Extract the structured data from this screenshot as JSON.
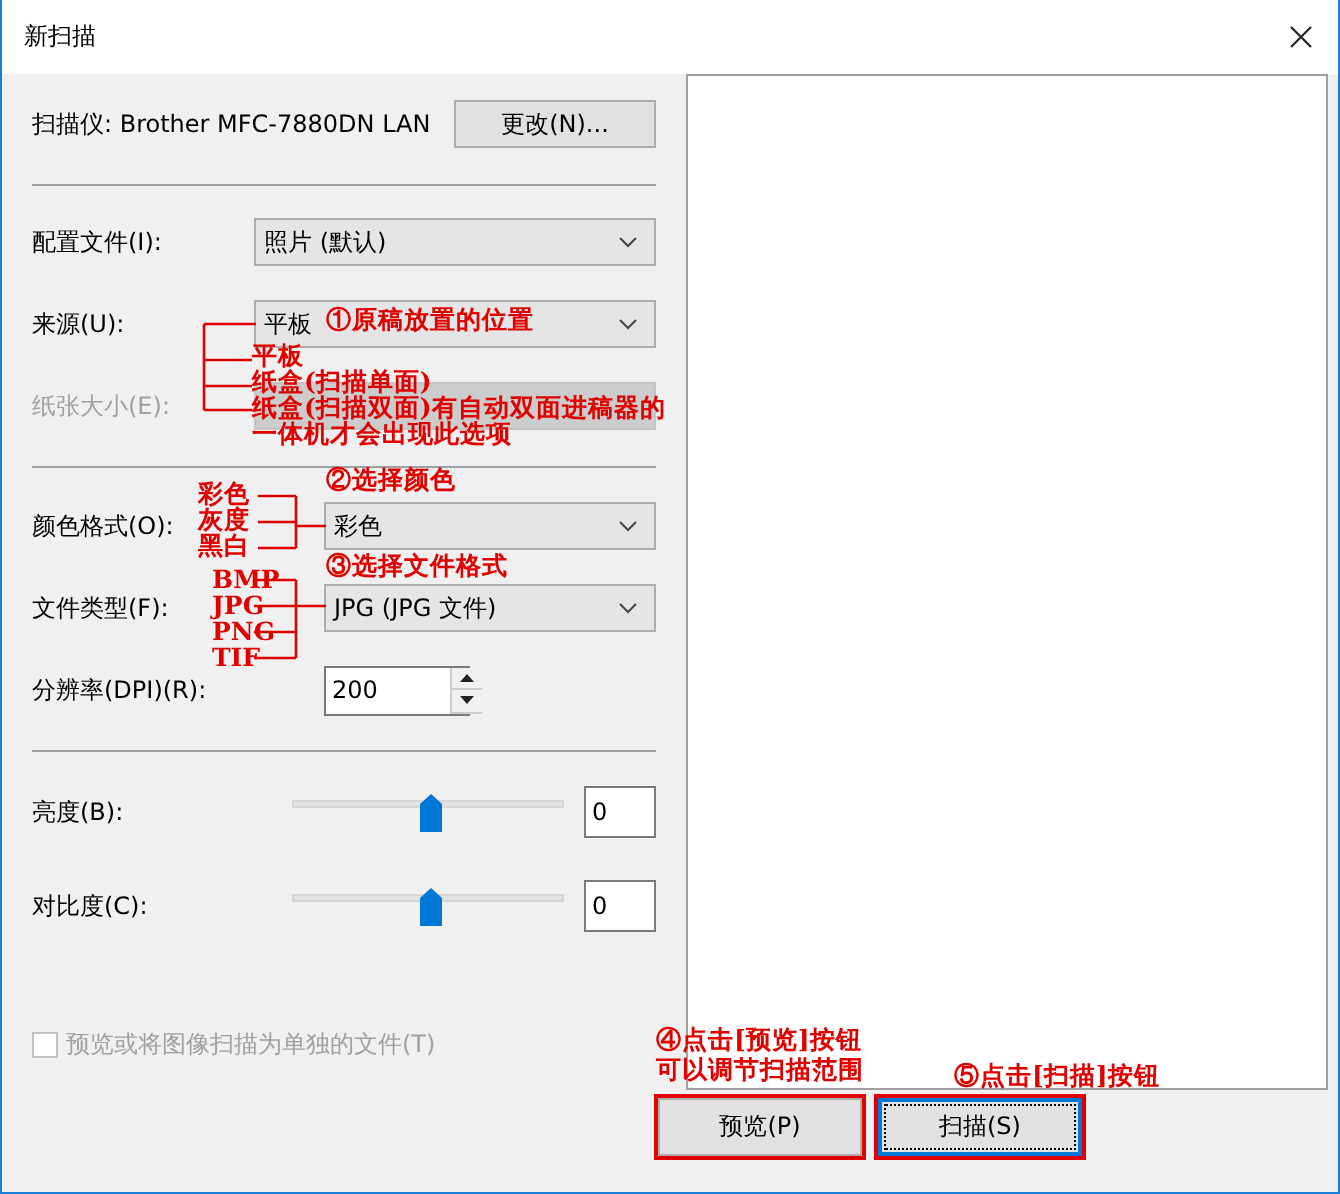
{
  "window": {
    "title": "新扫描"
  },
  "scanner": {
    "label": "扫描仪: Brother MFC-7880DN LAN",
    "button": "更改(N)..."
  },
  "groups": [
    [
      {
        "kind": "dropdown",
        "label": "配置文件(I):",
        "value": "照片 (默认)",
        "disabled": false
      },
      {
        "kind": "dropdown",
        "label": "来源(U):",
        "value": "平板",
        "disabled": false
      },
      {
        "kind": "dropdown",
        "label": "纸张大小(E):",
        "disabled": true
      }
    ],
    [
      {
        "kind": "dropdown",
        "label": "颜色格式(O):",
        "value": "彩色",
        "disabled": false
      },
      {
        "kind": "dropdown",
        "label": "文件类型(F):",
        "value": "JPG (JPG 文件)",
        "disabled": false
      },
      {
        "kind": "spinner",
        "label": "分辨率(DPI)(R):",
        "value": "200"
      }
    ],
    [
      {
        "kind": "slider",
        "label": "亮度(B):",
        "level": 0.5,
        "value": "0"
      },
      {
        "kind": "slider",
        "label": "对比度(C):",
        "level": 0.5,
        "value": "0"
      }
    ]
  ],
  "separate_files": {
    "label": "预览或将图像扫描为单独的文件(T)",
    "checked": false,
    "disabled": true
  },
  "buttons": [
    {
      "label": "预览(P)",
      "default": false,
      "highlighted": true
    },
    {
      "label": "扫描(S)",
      "default": true,
      "highlighted": true
    }
  ],
  "annotations": [
    {
      "text": "①原稿放置的位置"
    },
    {
      "text": "平板"
    },
    {
      "text": "纸盒(扫描单面)"
    },
    {
      "text": "纸盒(扫描双面)有自动双面进稿器的"
    },
    {
      "text": "一体机才会出现此选项"
    },
    {
      "text": "②选择颜色"
    },
    {
      "text": "彩色"
    },
    {
      "text": "灰度"
    },
    {
      "text": "黑白"
    },
    {
      "text": "③选择文件格式"
    },
    {
      "text": "BMP"
    },
    {
      "text": "JPG"
    },
    {
      "text": "PNG"
    },
    {
      "text": "TIF"
    },
    {
      "text": "④点击[预览]按钮"
    },
    {
      "text": "可以调节扫描范围"
    },
    {
      "text": "⑤点击[扫描]按钮"
    }
  ]
}
